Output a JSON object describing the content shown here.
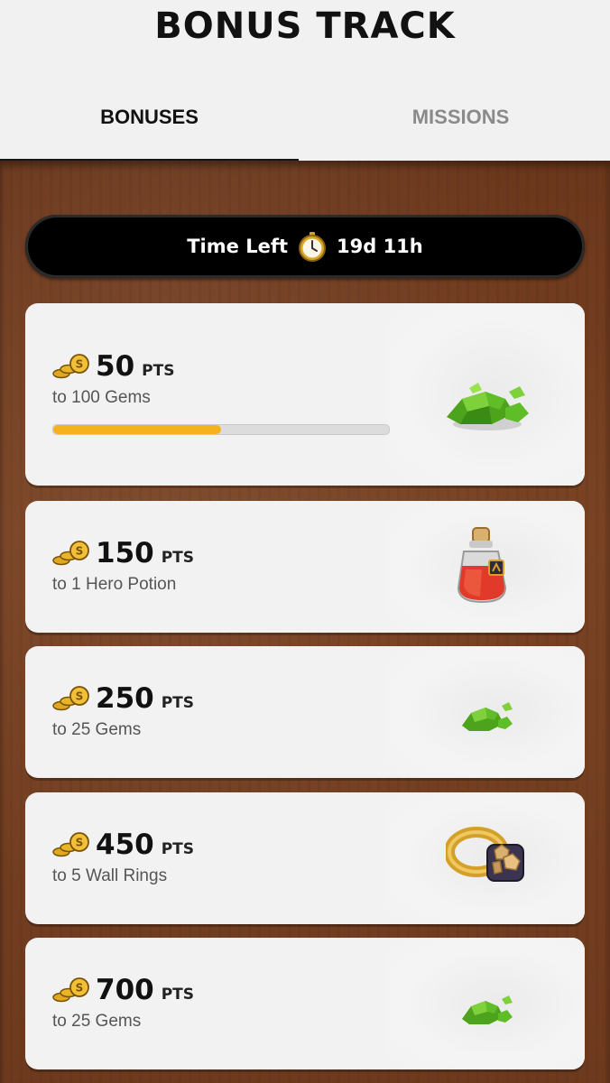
{
  "header": {
    "title": "BONUS TRACK"
  },
  "tabs": [
    {
      "label": "BONUSES",
      "active": true
    },
    {
      "label": "MISSIONS",
      "active": false
    }
  ],
  "timer": {
    "label": "Time Left",
    "value": "19d 11h"
  },
  "colors": {
    "accent": "#f5b21e",
    "wood": "#6e3a1e"
  },
  "bonuses": [
    {
      "points": "50",
      "unit": "PTS",
      "reward": "to 100 Gems",
      "icon": "gems-icon",
      "progress": 0.5
    },
    {
      "points": "150",
      "unit": "PTS",
      "reward": "to 1 Hero Potion",
      "icon": "hero-potion-icon"
    },
    {
      "points": "250",
      "unit": "PTS",
      "reward": "to 25 Gems",
      "icon": "gems-icon"
    },
    {
      "points": "450",
      "unit": "PTS",
      "reward": "to 5 Wall Rings",
      "icon": "wall-ring-icon"
    },
    {
      "points": "700",
      "unit": "PTS",
      "reward": "to 25 Gems",
      "icon": "gems-icon"
    }
  ]
}
